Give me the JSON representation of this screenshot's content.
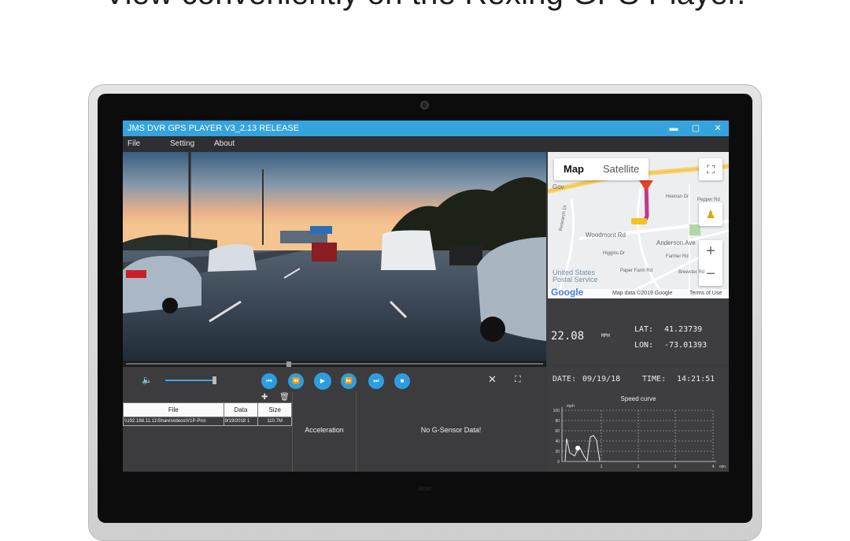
{
  "headline": "View conveniently on the Rexing GPS Player.",
  "brand_label": "acer",
  "window": {
    "title": "JMS DVR GPS PLAYER V3_2.13 RELEASE",
    "minimize": "▬",
    "maximize": "▢",
    "close": "✕"
  },
  "menu": {
    "file": "File",
    "setting": "Setting",
    "about": "About"
  },
  "map": {
    "type_map": "Map",
    "type_satellite": "Satellite",
    "fullscreen_icon": "⛶",
    "zoom_in": "+",
    "zoom_out": "−",
    "labels": {
      "gov": "Gov",
      "heenan": "Heenan Dr",
      "research": "Research Dr",
      "woodmont": "Woodmont Rd",
      "anderson": "Anderson Ave",
      "pepper": "Pepper Rd",
      "higgins": "Higgins Dr",
      "farmer": "Farmer Rd",
      "ups": "United States",
      "postal": "Postal Service",
      "paper": "Paper Farm Rd",
      "brewster": "Brewster Rd"
    },
    "google": "Google",
    "map_data": "Map data ©2019 Google",
    "terms": "Terms of Use"
  },
  "gps": {
    "speed": "22.08",
    "speed_unit": "MPH",
    "lat_label": "LAT:",
    "lat_value": "41.23739",
    "lon_label": "LON:",
    "lon_value": "-73.01393"
  },
  "datetime": {
    "date_label": "DATE:",
    "date_value": "09/19/18",
    "time_label": "TIME:",
    "time_value": "14:21:51"
  },
  "file_list": {
    "columns": [
      "File",
      "Data",
      "Size"
    ],
    "rows": [
      {
        "file": "\\\\192.168.11.11\\Share\\videos\\V1P-Pro\\",
        "data": "9/19/2018 1",
        "size": "110.7M"
      }
    ]
  },
  "acceleration_label": "Acceleration",
  "gsensor_message": "No G-Sensor Data!",
  "speed_curve": {
    "title": "Speed curve",
    "unit": "mph",
    "y_ticks": [
      "100",
      "80",
      "60",
      "40",
      "20",
      "0"
    ],
    "x_ticks": [
      "1",
      "2",
      "3",
      "4"
    ],
    "x_unit": "min"
  },
  "colors": {
    "titlebar": "#35a3dc",
    "playback_buttons": "#2e9de0",
    "route": "#c2368c",
    "pin": "#e8412c"
  },
  "icons": {
    "volume": "volume-icon",
    "prev": "skip-previous-icon",
    "rewind": "rewind-icon",
    "play": "play-icon",
    "forward": "fast-forward-icon",
    "next": "skip-next-icon",
    "stop": "stop-icon",
    "close": "close-x-icon",
    "fullscreen": "fullscreen-icon",
    "add": "add-icon",
    "delete": "trash-icon"
  }
}
